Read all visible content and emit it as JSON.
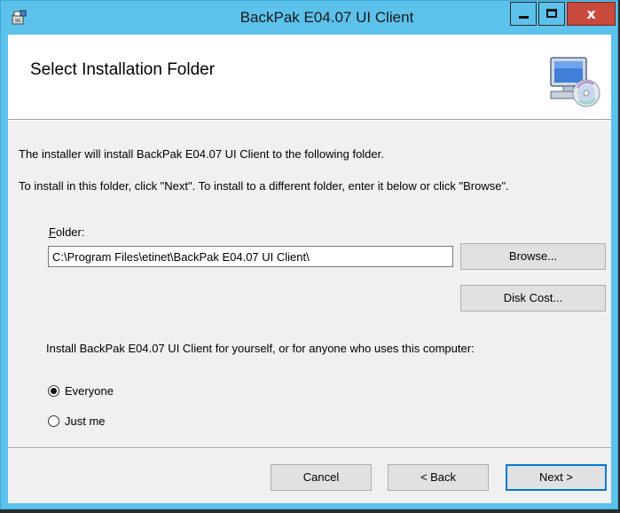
{
  "window": {
    "title": "BackPak E04.07 UI Client",
    "close_glyph": "x",
    "colors": {
      "titlebar": "#5cc2ec",
      "close": "#c74a3c"
    }
  },
  "banner": {
    "title": "Select Installation Folder",
    "icon": "computer-cd-icon"
  },
  "body": {
    "line1": "The installer will install BackPak E04.07 UI Client to the following folder.",
    "line2": "To install in this folder, click \"Next\". To install to a different folder, enter it below or click \"Browse\".",
    "folder_label_accel": "F",
    "folder_label_rest": "older:",
    "folder_value": "C:\\Program Files\\etinet\\BackPak E04.07 UI Client\\",
    "browse_label": "Browse...",
    "disk_cost_label": "Disk Cost...",
    "install_for": "Install BackPak E04.07 UI Client for yourself, or for anyone who uses this computer:",
    "options": [
      {
        "label": "Everyone",
        "checked": true
      },
      {
        "label": "Just me",
        "checked": false
      }
    ]
  },
  "footer": {
    "cancel_label": "Cancel",
    "back_label": "< Back",
    "next_label": "Next >"
  }
}
